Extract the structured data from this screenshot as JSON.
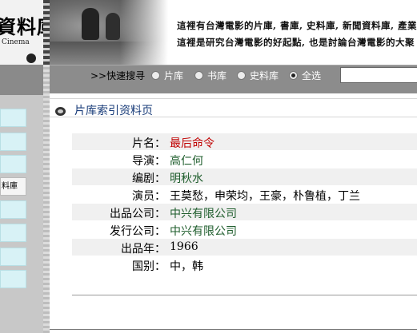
{
  "header": {
    "logo_title": "資料庫",
    "logo_subtitle": "Cinema",
    "tagline_1": "這裡有台灣電影的片庫, 書庫, 史料庫, 新聞資料庫, 產業資",
    "tagline_2": "這裡是研究台灣電影的好起點, 也是討論台灣電影的大聚"
  },
  "sidebar": {
    "items": [
      {
        "label": ""
      },
      {
        "label": ""
      },
      {
        "label": ""
      },
      {
        "label": "料庫"
      },
      {
        "label": ""
      },
      {
        "label": ""
      },
      {
        "label": ""
      },
      {
        "label": ""
      }
    ]
  },
  "search": {
    "label": ">>快速搜寻",
    "options": [
      {
        "label": "片库",
        "checked": false
      },
      {
        "label": "书库",
        "checked": false
      },
      {
        "label": "史料库",
        "checked": false
      },
      {
        "label": "全选",
        "checked": true
      }
    ],
    "input_value": ""
  },
  "page": {
    "title": "片库索引资料页"
  },
  "film": {
    "rows": [
      {
        "label": "片名：",
        "value": "最后命令"
      },
      {
        "label": "导演：",
        "value": "高仁何"
      },
      {
        "label": "编剧：",
        "value": "明秋水"
      },
      {
        "label": "演员：",
        "value": "王莫愁，申荣均，王豪，朴鲁植，丁兰"
      },
      {
        "label": "出品公司：",
        "value": "中兴有限公司"
      },
      {
        "label": "发行公司：",
        "value": "中兴有限公司"
      },
      {
        "label": "出品年：",
        "value": "1966"
      },
      {
        "label": "国别：",
        "value": "中，韩"
      }
    ]
  },
  "colors": {
    "title_value": "#c00000",
    "link_value": "#1d5c2b",
    "page_title": "#1a3d7a",
    "search_bar": "#8c8c8c",
    "side_box": "#d8f2f6"
  }
}
